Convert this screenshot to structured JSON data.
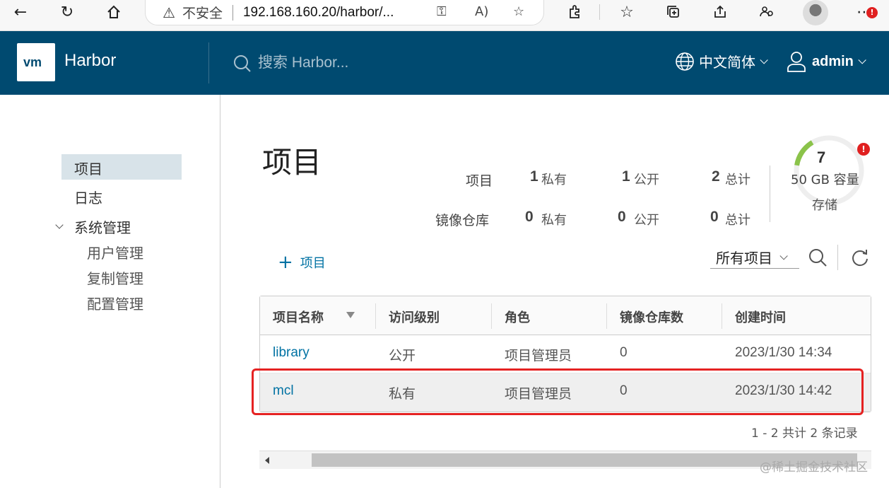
{
  "browser": {
    "security_label": "不安全",
    "url": "192.168.160.20/harbor/..."
  },
  "header": {
    "logo_text": "vm",
    "app_name": "Harbor",
    "search_placeholder": "搜索 Harbor...",
    "language": "中文简体",
    "user": "admin"
  },
  "sidebar": {
    "items": [
      {
        "label": "项目"
      },
      {
        "label": "日志"
      },
      {
        "label": "系统管理"
      }
    ],
    "admin_sub": [
      {
        "label": "用户管理"
      },
      {
        "label": "复制管理"
      },
      {
        "label": "配置管理"
      }
    ]
  },
  "main": {
    "title": "项目",
    "stats": {
      "projects_label": "项目",
      "repos_label": "镜像仓库",
      "private_label": "私有",
      "public_label": "公开",
      "total_label": "总计",
      "projects": {
        "private": "1",
        "public": "1",
        "total": "2"
      },
      "repos": {
        "private": "0",
        "public": "0",
        "total": "0"
      }
    },
    "storage": {
      "count": "7",
      "capacity": "50 GB 容量",
      "label": "存储",
      "alert": "!",
      "used_fraction": 0.14
    },
    "add_project_label": "项目",
    "filter_value": "所有项目",
    "table": {
      "columns": [
        "项目名称",
        "访问级别",
        "角色",
        "镜像仓库数",
        "创建时间"
      ],
      "rows": [
        {
          "name": "library",
          "access": "公开",
          "role": "项目管理员",
          "repos": "0",
          "created": "2023/1/30 14:34"
        },
        {
          "name": "mcl",
          "access": "私有",
          "role": "项目管理员",
          "repos": "0",
          "created": "2023/1/30 14:42"
        }
      ],
      "footer": "1 - 2 共计 2 条记录"
    }
  },
  "watermark": "@稀土掘金技术社区",
  "colors": {
    "header_bg": "#004a70",
    "link": "#0072a3",
    "highlight": "#e52222",
    "gauge": "#8bc34a"
  }
}
